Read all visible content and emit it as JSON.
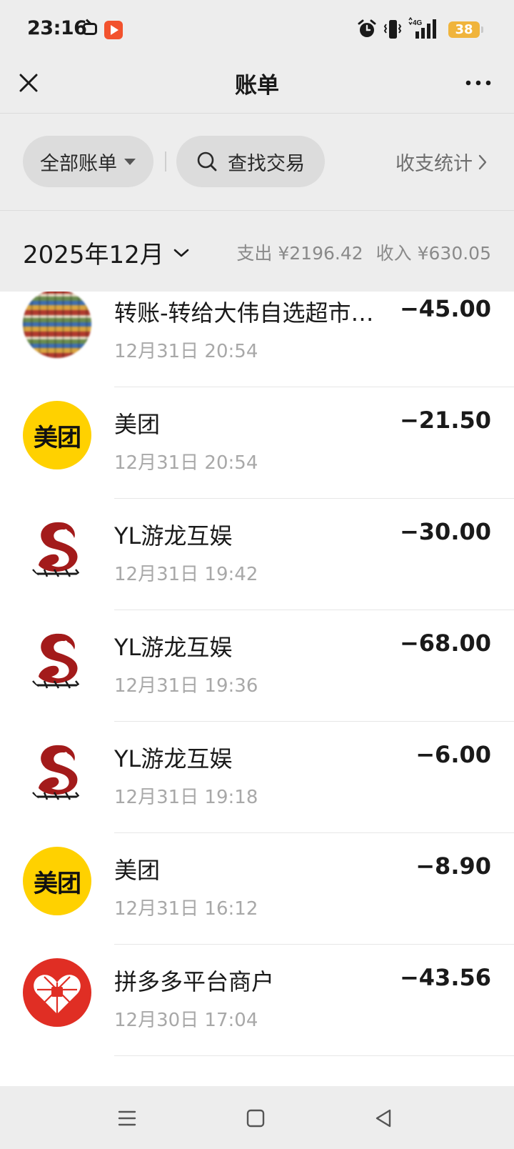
{
  "status_bar": {
    "time": "23:16",
    "network": "4G",
    "battery": "38",
    "icons": [
      "tv-icon",
      "play-app-icon",
      "alarm-icon",
      "vibrate-icon",
      "signal-icon",
      "battery-icon"
    ]
  },
  "header": {
    "title": "账单",
    "close_icon": "close-icon",
    "more_icon": "more-dots-icon"
  },
  "filters": {
    "all_bills_label": "全部账单",
    "search_label": "查找交易",
    "stats_label": "收支统计"
  },
  "month_summary": {
    "month": "2025年12月",
    "expense_text": "支出 ¥2196.42",
    "income_text": "收入 ¥630.05"
  },
  "transactions": [
    {
      "avatar": "store-photo",
      "name": "转账-转给大伟自选超市…",
      "time": "12月31日 20:54",
      "amount": "−45.00"
    },
    {
      "avatar": "meituan-logo",
      "avatar_text": "美团",
      "name": "美团",
      "time": "12月31日 20:54",
      "amount": "−21.50"
    },
    {
      "avatar": "dragon-logo",
      "name": "YL游龙互娱",
      "time": "12月31日 19:42",
      "amount": "−30.00"
    },
    {
      "avatar": "dragon-logo",
      "name": "YL游龙互娱",
      "time": "12月31日 19:36",
      "amount": "−68.00"
    },
    {
      "avatar": "dragon-logo",
      "name": "YL游龙互娱",
      "time": "12月31日 19:18",
      "amount": "−6.00"
    },
    {
      "avatar": "meituan-logo",
      "avatar_text": "美团",
      "name": "美团",
      "time": "12月31日 16:12",
      "amount": "−8.90"
    },
    {
      "avatar": "pinduoduo-logo",
      "name": "拼多多平台商户",
      "time": "12月30日 17:04",
      "amount": "−43.56"
    }
  ],
  "nav_bar": {
    "icons": [
      "menu-icon",
      "home-icon",
      "back-icon"
    ]
  },
  "colors": {
    "background": "#ededed",
    "list_background": "#ffffff",
    "meituan_yellow": "#ffd100",
    "pinduoduo_red": "#e02e24",
    "dragon_red": "#a31b1b",
    "battery_amber": "#f0b43c"
  }
}
